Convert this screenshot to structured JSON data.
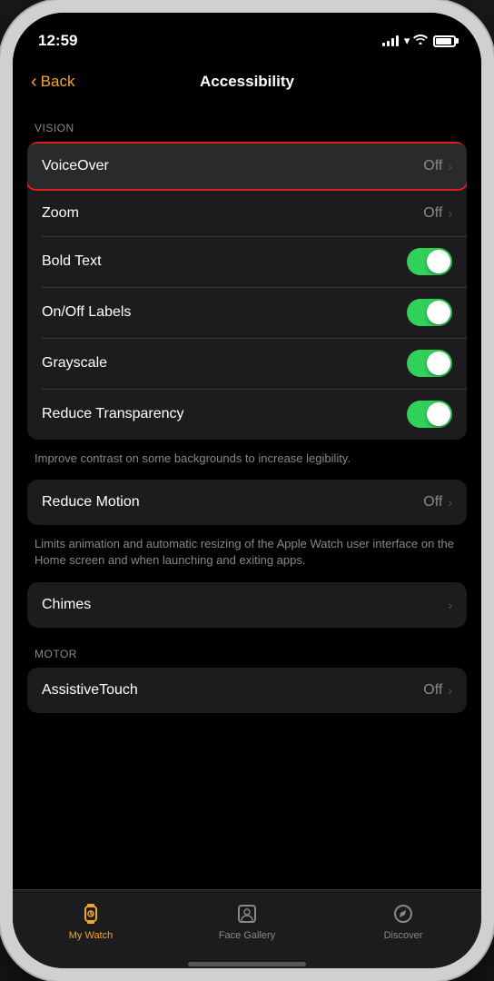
{
  "statusBar": {
    "time": "12:59",
    "timeIcon": "location-arrow-icon"
  },
  "navBar": {
    "backLabel": "Back",
    "title": "Accessibility"
  },
  "sections": {
    "vision": {
      "label": "VISION",
      "rows": [
        {
          "id": "voiceover",
          "label": "VoiceOver",
          "type": "chevron",
          "value": "Off",
          "highlighted": true
        },
        {
          "id": "zoom",
          "label": "Zoom",
          "type": "chevron",
          "value": "Off",
          "highlighted": false
        },
        {
          "id": "boldtext",
          "label": "Bold Text",
          "type": "toggle",
          "on": true
        },
        {
          "id": "onofflabels",
          "label": "On/Off Labels",
          "type": "toggle",
          "on": true
        },
        {
          "id": "grayscale",
          "label": "Grayscale",
          "type": "toggle",
          "on": true
        },
        {
          "id": "reducetransparency",
          "label": "Reduce Transparency",
          "type": "toggle",
          "on": true
        }
      ],
      "description": "Improve contrast on some backgrounds to increase legibility."
    },
    "motion": {
      "rows": [
        {
          "id": "reducemotion",
          "label": "Reduce Motion",
          "type": "chevron",
          "value": "Off"
        }
      ],
      "description": "Limits animation and automatic resizing of the Apple Watch user interface on the Home screen and when launching and exiting apps."
    },
    "chimes": {
      "rows": [
        {
          "id": "chimes",
          "label": "Chimes",
          "type": "chevron",
          "value": ""
        }
      ]
    },
    "motor": {
      "label": "MOTOR",
      "rows": [
        {
          "id": "assistivetouch",
          "label": "AssistiveTouch",
          "type": "chevron",
          "value": "Off"
        }
      ]
    }
  },
  "tabBar": {
    "items": [
      {
        "id": "mywatch",
        "label": "My Watch",
        "active": true
      },
      {
        "id": "facegallery",
        "label": "Face Gallery",
        "active": false
      },
      {
        "id": "discover",
        "label": "Discover",
        "active": false
      }
    ]
  }
}
